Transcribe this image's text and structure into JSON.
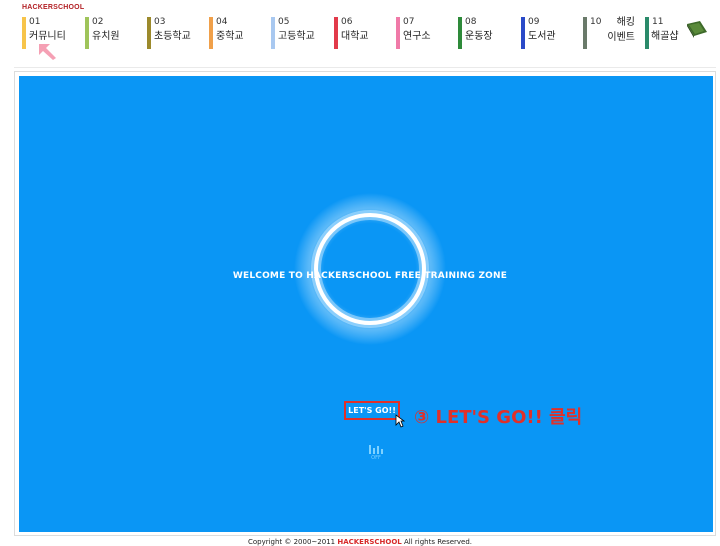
{
  "brand": "HACKERSCHOOL",
  "nav": {
    "items": [
      {
        "num": "01",
        "label": "커뮤니티",
        "color": "#f7c44a"
      },
      {
        "num": "02",
        "label": "유치원",
        "color": "#9fc45a"
      },
      {
        "num": "03",
        "label": "초등학교",
        "color": "#9c8a2c"
      },
      {
        "num": "04",
        "label": "중학교",
        "color": "#f0a04a"
      },
      {
        "num": "05",
        "label": "고등학교",
        "color": "#a8c8f0"
      },
      {
        "num": "06",
        "label": "대학교",
        "color": "#e23a4a"
      },
      {
        "num": "07",
        "label": "연구소",
        "color": "#f07aa8"
      },
      {
        "num": "08",
        "label": "운동장",
        "color": "#2e8a3a"
      },
      {
        "num": "09",
        "label": "도서관",
        "color": "#2a4ac8"
      },
      {
        "num": "10",
        "label_line1": "해킹",
        "label_line2": "이벤트",
        "color": "#6a7a6a"
      },
      {
        "num": "11",
        "label_line1": "",
        "label_line2": "해골샵",
        "color": "#2a8a6a"
      }
    ]
  },
  "stage": {
    "welcome_text": "WELCOME TO HACKERSCHOOL FREE TRAINING ZONE",
    "letsgo_button": "LET'S GO!!",
    "annotation": "③ LET'S GO!! 클릭",
    "sound_label": "OFF",
    "background": "#0a96f5",
    "highlight_color": "#e0302a"
  },
  "footer": {
    "prefix": "Copyright © 2000~2011",
    "brand": "HACKERSCHOOL",
    "suffix": "All rights Reserved."
  }
}
